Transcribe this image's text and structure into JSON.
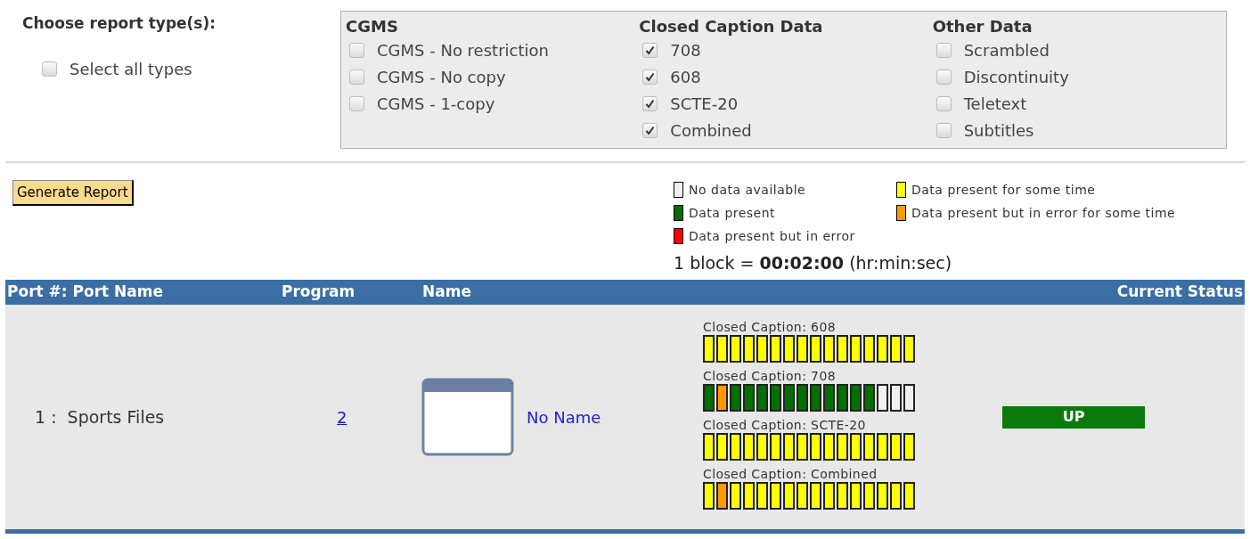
{
  "report_types": {
    "title": "Choose report type(s):",
    "select_all": {
      "label": "Select all types",
      "checked": false
    },
    "groups": [
      {
        "title": "CGMS",
        "options": [
          {
            "label": "CGMS - No restriction",
            "checked": false
          },
          {
            "label": "CGMS - No copy",
            "checked": false
          },
          {
            "label": "CGMS - 1-copy",
            "checked": false
          }
        ]
      },
      {
        "title": "Closed Caption Data",
        "options": [
          {
            "label": "708",
            "checked": true
          },
          {
            "label": "608",
            "checked": true
          },
          {
            "label": "SCTE-20",
            "checked": true
          },
          {
            "label": "Combined",
            "checked": true
          }
        ]
      },
      {
        "title": "Other Data",
        "options": [
          {
            "label": "Scrambled",
            "checked": false
          },
          {
            "label": "Discontinuity",
            "checked": false
          },
          {
            "label": "Teletext",
            "checked": false
          },
          {
            "label": "Subtitles",
            "checked": false
          }
        ]
      }
    ]
  },
  "generate_button": "Generate Report",
  "legend": {
    "items": [
      {
        "label": "No data available",
        "color": "#f0f0f0"
      },
      {
        "label": "Data present for some time",
        "color": "#ffff00"
      },
      {
        "label": "Data present",
        "color": "#007000"
      },
      {
        "label": "Data present but in error for some time",
        "color": "#ff9900"
      },
      {
        "label": "Data present but in error",
        "color": "#ff0000"
      }
    ],
    "block_prefix": "1 block = ",
    "block_time": "00:02:00",
    "block_unit": "(hr:min:sec)"
  },
  "table": {
    "columns": [
      "Port #: Port Name",
      "Program",
      "Name",
      "Current Status"
    ],
    "rows": [
      {
        "port": "1 :  Sports Files",
        "program": "2",
        "name": "No Name",
        "status": "UP",
        "timelines": [
          {
            "label": "Closed Caption: 608",
            "blocks": [
              {
                "color": "#ffff00"
              },
              {
                "color": "#ffff00"
              },
              {
                "color": "#ffff00"
              },
              {
                "color": "#ffff00"
              },
              {
                "color": "#ffff00"
              },
              {
                "color": "#ffff00"
              },
              {
                "color": "#ffff00"
              },
              {
                "color": "#ffff00"
              },
              {
                "color": "#ffff00"
              },
              {
                "color": "#ffff00"
              },
              {
                "color": "#ffff00"
              },
              {
                "color": "#ffff00"
              },
              {
                "color": "#ffff00"
              },
              {
                "color": "#ffff00"
              },
              {
                "color": "#ffff00"
              },
              {
                "color": "#ffff00"
              }
            ]
          },
          {
            "label": "Closed Caption: 708",
            "blocks": [
              {
                "color": "#007000"
              },
              {
                "color": "#ff9900"
              },
              {
                "color": "#007000"
              },
              {
                "color": "#007000"
              },
              {
                "color": "#007000"
              },
              {
                "color": "#007000"
              },
              {
                "color": "#007000"
              },
              {
                "color": "#007000"
              },
              {
                "color": "#007000"
              },
              {
                "color": "#007000"
              },
              {
                "color": "#007000"
              },
              {
                "color": "#007000"
              },
              {
                "color": "#007000"
              },
              {
                "color": "#f0f0f0"
              },
              {
                "color": "#f0f0f0"
              },
              {
                "color": "#f0f0f0"
              }
            ]
          },
          {
            "label": "Closed Caption: SCTE-20",
            "blocks": [
              {
                "color": "#ffff00"
              },
              {
                "color": "#ffff00"
              },
              {
                "color": "#ffff00"
              },
              {
                "color": "#ffff00"
              },
              {
                "color": "#ffff00"
              },
              {
                "color": "#ffff00"
              },
              {
                "color": "#ffff00"
              },
              {
                "color": "#ffff00"
              },
              {
                "color": "#ffff00"
              },
              {
                "color": "#ffff00"
              },
              {
                "color": "#ffff00"
              },
              {
                "color": "#ffff00"
              },
              {
                "color": "#ffff00"
              },
              {
                "color": "#ffff00"
              },
              {
                "color": "#ffff00"
              },
              {
                "color": "#ffff00"
              }
            ]
          },
          {
            "label": "Closed Caption: Combined",
            "blocks": [
              {
                "color": "#ffff00"
              },
              {
                "color": "#ff9900"
              },
              {
                "color": "#ffff00"
              },
              {
                "color": "#ffff00"
              },
              {
                "color": "#ffff00"
              },
              {
                "color": "#ffff00"
              },
              {
                "color": "#ffff00"
              },
              {
                "color": "#ffff00"
              },
              {
                "color": "#ffff00"
              },
              {
                "color": "#ffff00"
              },
              {
                "color": "#ffff00"
              },
              {
                "color": "#ffff00"
              },
              {
                "color": "#ffff00"
              },
              {
                "color": "#ffff00"
              },
              {
                "color": "#ffff00"
              },
              {
                "color": "#ffff00"
              }
            ]
          }
        ]
      }
    ]
  }
}
